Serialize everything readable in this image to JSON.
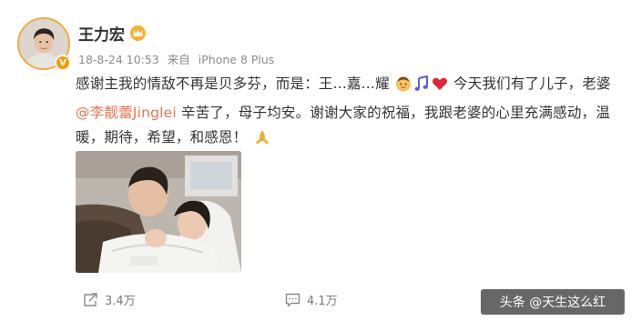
{
  "user": {
    "name": "王力宏",
    "badge_letter": "V"
  },
  "post": {
    "date": "18-8-24 10:53",
    "source_prefix": "来自",
    "source": "iPhone 8 Plus",
    "text_part1": "感谢主我的情敌不再是贝多芬，而是：王...嘉...耀",
    "text_part2": "今天我们有了儿子，老婆",
    "mention": "@李靓蕾Jinglei",
    "text_part3": "辛苦了，母子均安。谢谢大家的祝福，我跟老婆的心里充满感动，温暖，期待，希望，和感恩！"
  },
  "actions": {
    "repost_count": "3.4万",
    "comment_count": "4.1万"
  },
  "watermark": "头条 @天生这么红",
  "icons": {
    "verified": "verified-v-badge-icon",
    "crown": "crown-level-icon",
    "baby": "baby-emoji-icon",
    "music": "music-note-emoji-icon",
    "heart": "red-heart-emoji-icon",
    "pray": "praying-hands-emoji-icon",
    "repost": "repost-icon",
    "comment": "comment-icon"
  },
  "colors": {
    "mention": "#eb7350",
    "heart": "#e2263b",
    "music": "#5b5fdc",
    "verified_badge": "#f79a00"
  }
}
